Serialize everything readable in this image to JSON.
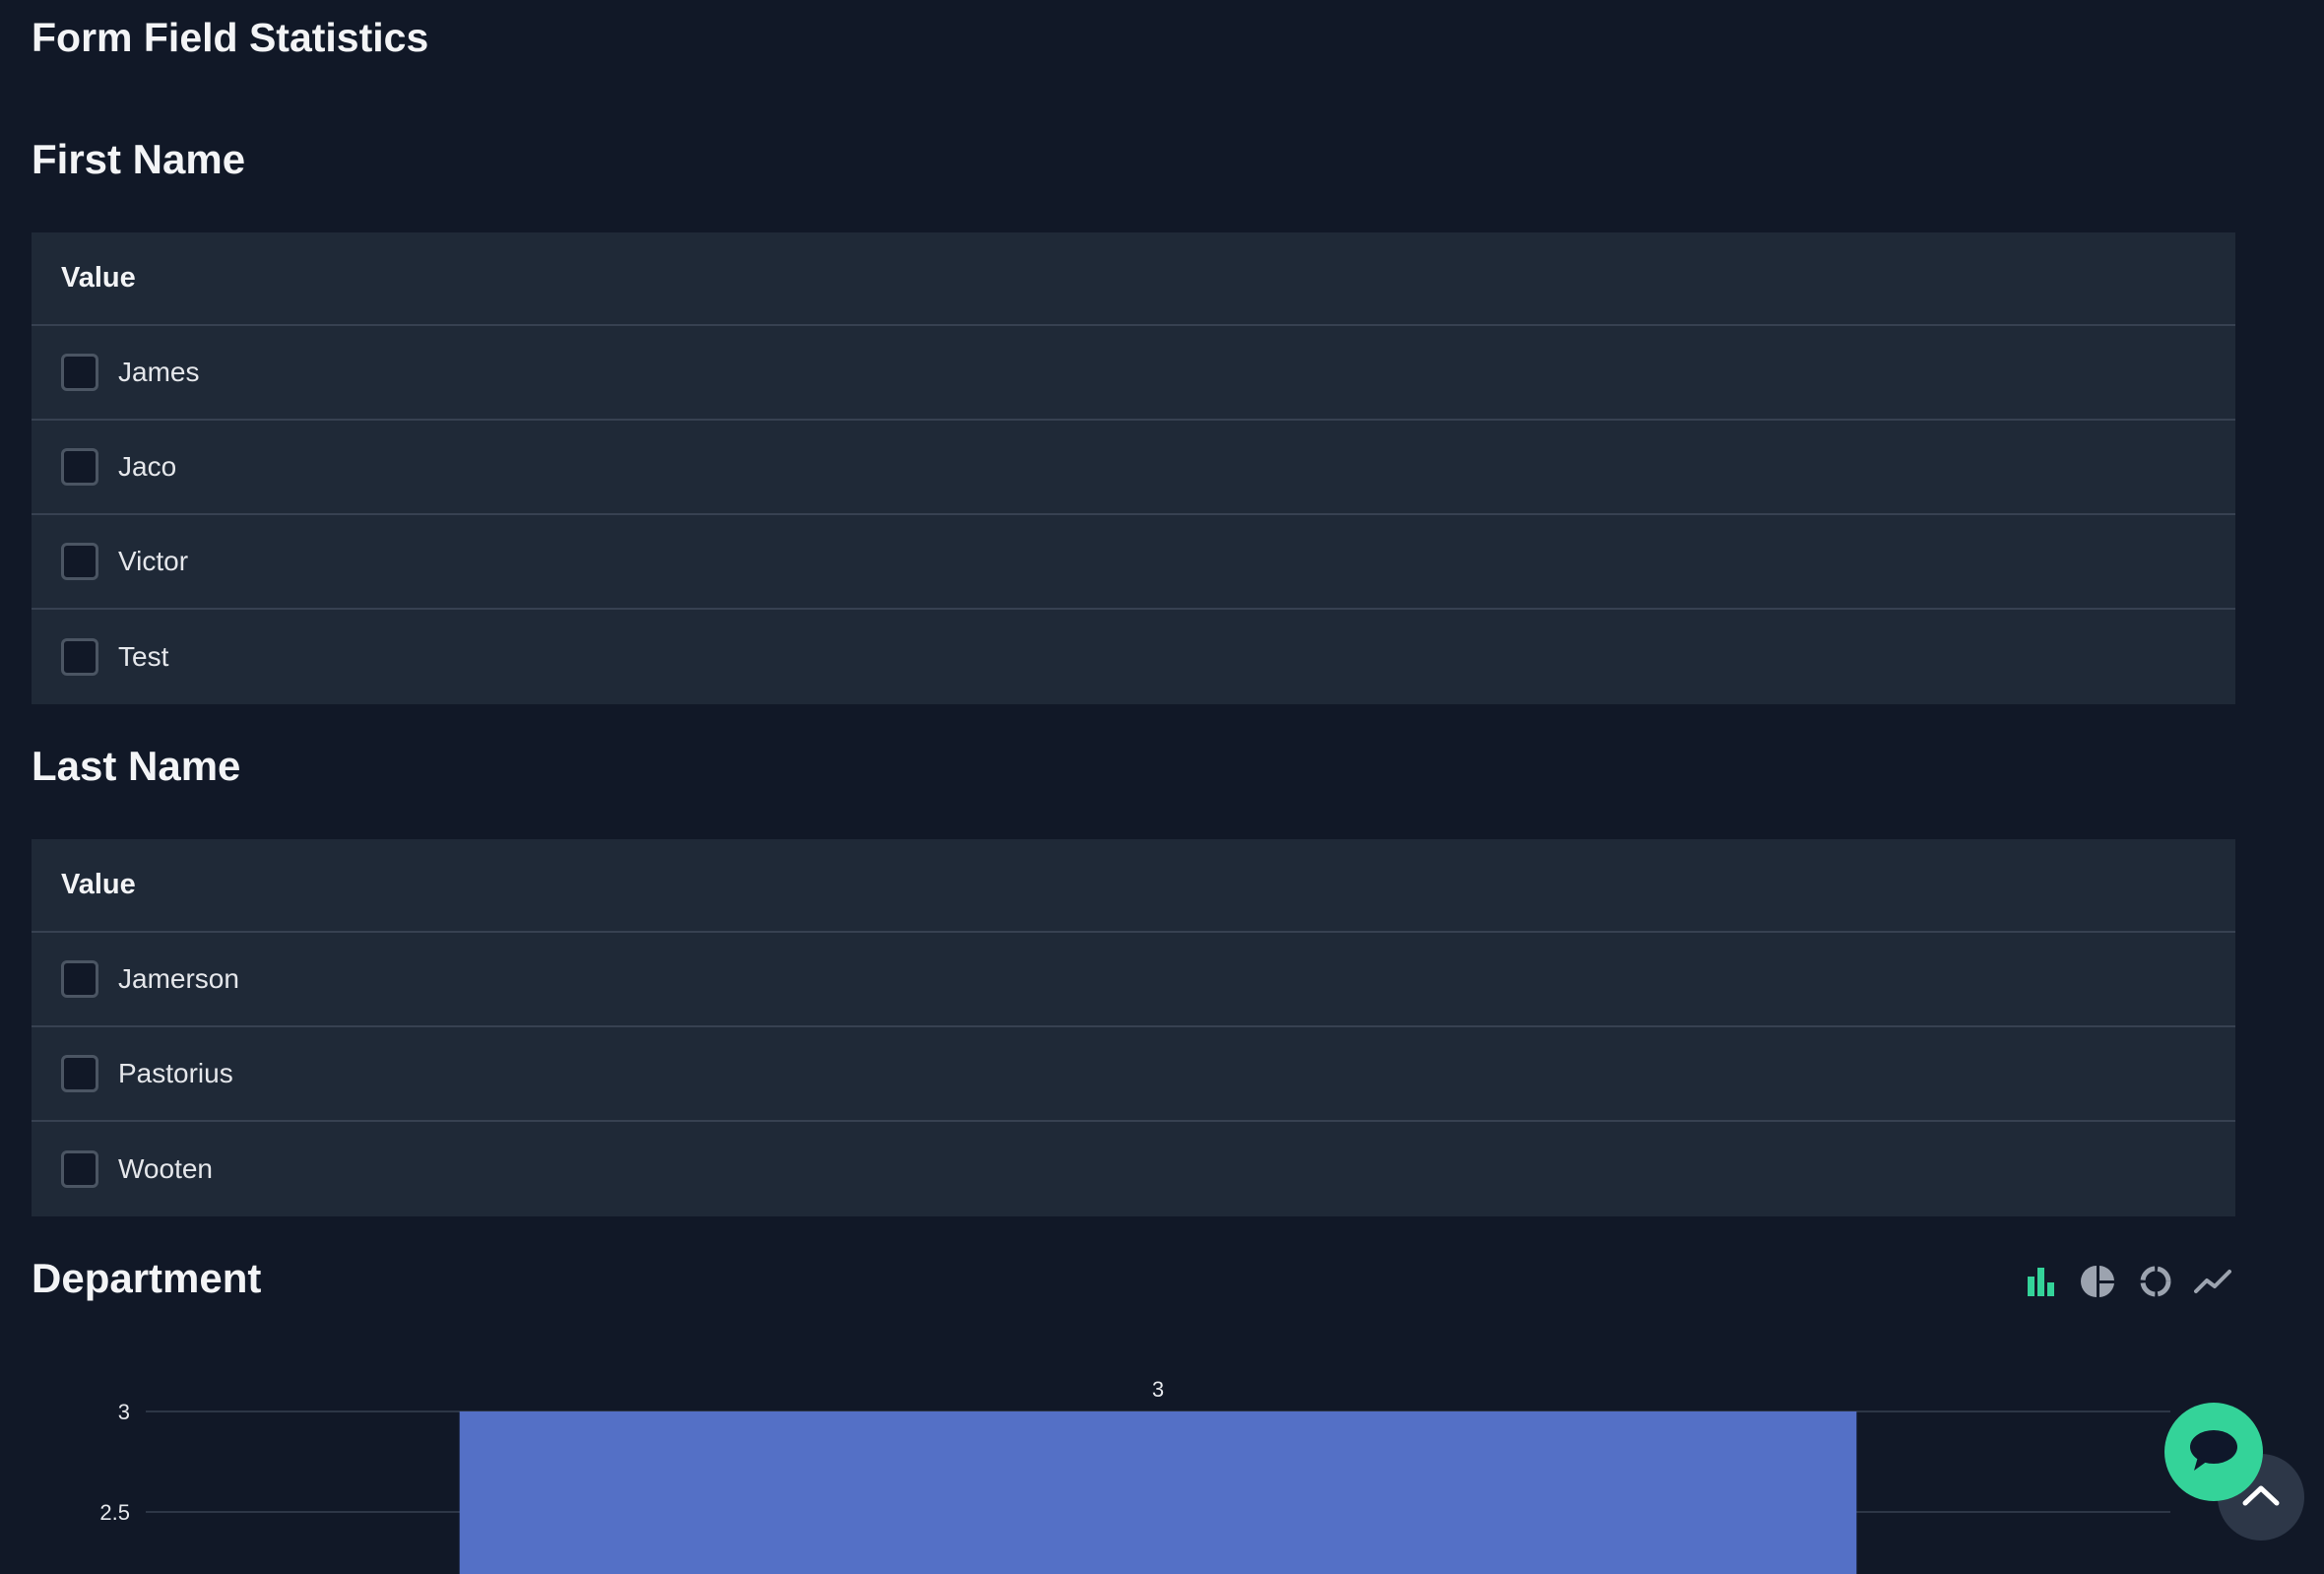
{
  "page": {
    "title": "Form Field Statistics"
  },
  "sections": [
    {
      "title": "First Name",
      "column_header": "Value",
      "rows": [
        "James",
        "Jaco",
        "Victor",
        "Test"
      ]
    },
    {
      "title": "Last Name",
      "column_header": "Value",
      "rows": [
        "Jamerson",
        "Pastorius",
        "Wooten"
      ]
    }
  ],
  "department": {
    "title": "Department",
    "chart_types": [
      "bar-chart-icon",
      "pie-chart-icon",
      "donut-chart-icon",
      "line-chart-icon"
    ],
    "active_chart_type": "bar-chart-icon"
  },
  "colors": {
    "background": "#111827",
    "panel": "#1f2937",
    "accent": "#34d399",
    "bar": "#5470c6"
  },
  "chart_data": {
    "type": "bar",
    "categories": [
      ""
    ],
    "values": [
      3
    ],
    "data_labels": [
      "3"
    ],
    "y_ticks": [
      "3",
      "2.5"
    ],
    "title": "",
    "xlabel": "",
    "ylabel": ""
  }
}
